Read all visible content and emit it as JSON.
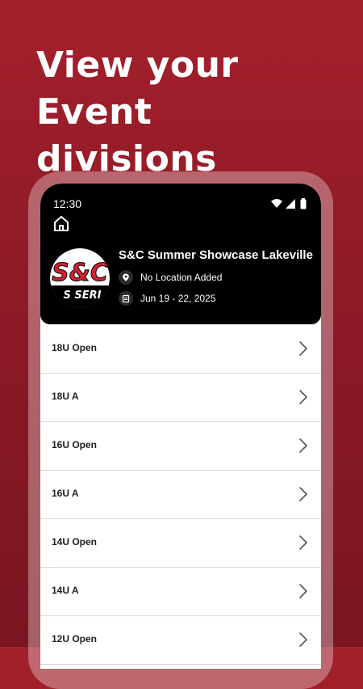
{
  "promo": {
    "headline_line1": "View your",
    "headline_line2": "Event divisions"
  },
  "status_bar": {
    "time": "12:30"
  },
  "event": {
    "logo_text": "S&C",
    "logo_subtext": "S SERI",
    "title": "S&C Summer Showcase Lakeville",
    "location": "No Location Added",
    "dates": "Jun 19 - 22, 2025"
  },
  "divisions": [
    {
      "label": "18U Open"
    },
    {
      "label": "18U A"
    },
    {
      "label": "16U Open"
    },
    {
      "label": "16U A"
    },
    {
      "label": "14U Open"
    },
    {
      "label": "14U A"
    },
    {
      "label": "12U Open"
    }
  ],
  "colors": {
    "background": "#8a1925",
    "logo_red": "#d4202e",
    "panel": "#000000"
  },
  "icons": {
    "home": "home-icon",
    "wifi": "wifi-icon",
    "signal": "signal-icon",
    "battery": "battery-icon",
    "location": "location-pin-icon",
    "calendar": "calendar-icon",
    "chevron": "chevron-right-icon"
  }
}
